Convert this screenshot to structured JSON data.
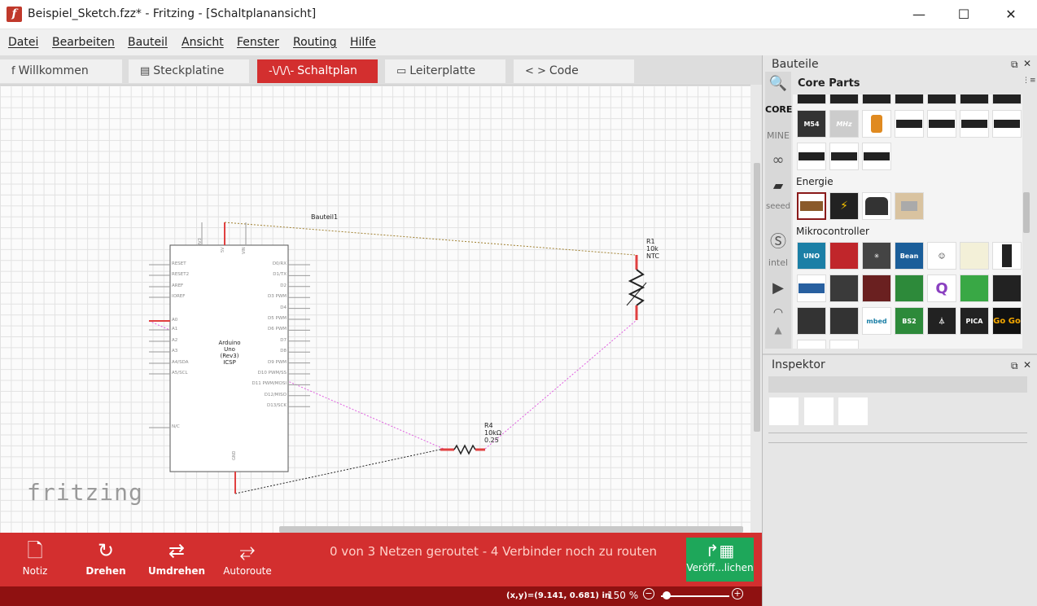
{
  "window": {
    "title": "Beispiel_Sketch.fzz* - Fritzing - [Schaltplanansicht]",
    "app_icon": "f",
    "controls": {
      "minimize": "—",
      "maximize": "☐",
      "close": "✕"
    }
  },
  "menu": [
    "Datei",
    "Bearbeiten",
    "Bauteil",
    "Ansicht",
    "Fenster",
    "Routing",
    "Hilfe"
  ],
  "tabs": [
    {
      "label": "Willkommen",
      "icon": "f"
    },
    {
      "label": "Steckplatine",
      "icon": "▤"
    },
    {
      "label": "Schaltplan",
      "icon": "-\\/\\/\\-"
    },
    {
      "label": "Leiterplatte",
      "icon": "▭"
    },
    {
      "label": "Code",
      "icon": "< >"
    }
  ],
  "active_tab": "Schaltplan",
  "schematic": {
    "arduino": {
      "name_lines": [
        "Arduino",
        "Uno",
        "(Rev3)",
        "ICSP"
      ],
      "top_pins": [
        "3V3",
        "5V",
        "VIN"
      ],
      "left_pins": [
        "RESET",
        "RESET2",
        "AREF",
        "IOREF",
        "A0",
        "A1",
        "A2",
        "A3",
        "A4/SDA",
        "A5/SCL",
        "N/C"
      ],
      "right_pins": [
        "D0/RX",
        "D1/TX",
        "D2",
        "D3 PWM",
        "D4",
        "D5 PWM",
        "D6 PWM",
        "D7",
        "D8",
        "D9 PWM",
        "D10 PWM/SS",
        "D11 PWM/MOSI",
        "D12/MISO",
        "D13/SCK"
      ],
      "bottom_pin": "GND"
    },
    "bauteil_label": "Bauteil1",
    "r1": [
      "R1",
      "10k",
      "NTC"
    ],
    "r4": [
      "R4",
      "10kΩ",
      "0.25"
    ]
  },
  "watermark": "fritzing",
  "toolbar": {
    "notiz": "Notiz",
    "drehen": "Drehen",
    "umdrehen": "Umdrehen",
    "autoroute": "Autoroute",
    "status": "0 von 3 Netzen geroutet - 4 Verbinder noch zu routen",
    "publish": "Veröff...lichen"
  },
  "statusbar": {
    "coords": "(x,y)=(9.141, 0.681) in",
    "zoom": "150 %"
  },
  "parts_panel": {
    "title": "Bauteile",
    "bin_title": "Core Parts",
    "side_tabs": [
      "CORE",
      "MINE"
    ],
    "categories": [
      "Energie",
      "Mikrocontroller"
    ],
    "part_labels": {
      "m54": "M54",
      "mhz": "MHz",
      "uno": "UNO",
      "bean": "Bean",
      "bs2": "BS2",
      "pica": "PICA",
      "gogo": "Go Go",
      "mbed": "mbed"
    }
  },
  "inspector": {
    "title": "Inspektor"
  },
  "icons": {
    "search": "search-icon",
    "dock_float": "float-icon",
    "dock_close": "close-icon"
  },
  "colors": {
    "accent": "#d32f2f",
    "statusbar": "#8f1111",
    "publish": "#1ea75a"
  }
}
